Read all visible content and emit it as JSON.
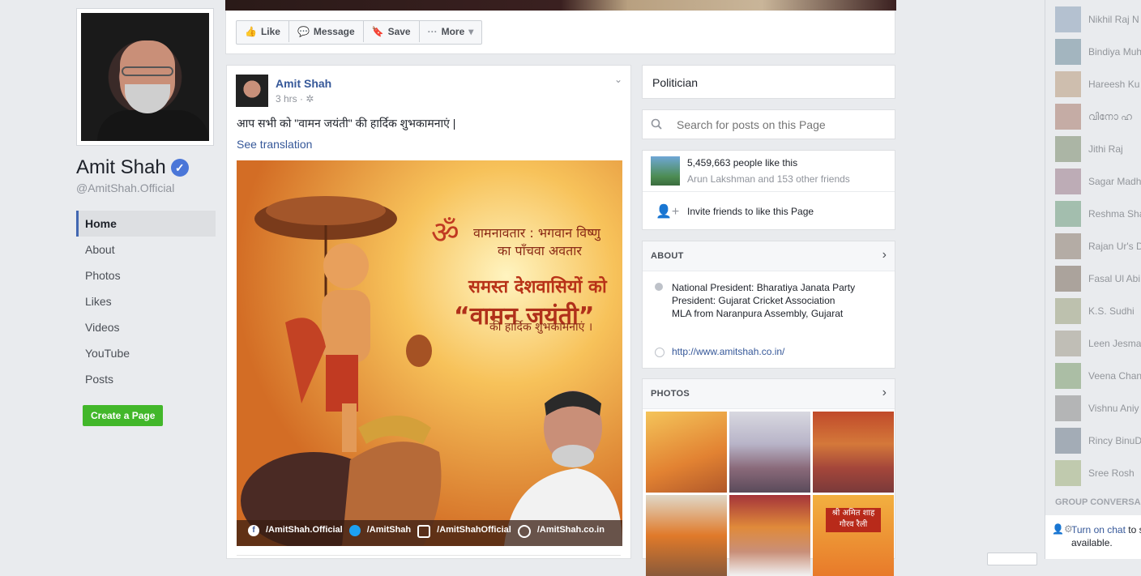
{
  "page": {
    "name": "Amit Shah",
    "handle": "@AmitShah.Official",
    "verified_icon": "verified-badge-icon"
  },
  "left_nav": {
    "items": [
      {
        "label": "Home",
        "active": true
      },
      {
        "label": "About"
      },
      {
        "label": "Photos"
      },
      {
        "label": "Likes"
      },
      {
        "label": "Videos"
      },
      {
        "label": "YouTube"
      },
      {
        "label": "Posts"
      }
    ],
    "create_page": "Create a Page"
  },
  "action_bar": {
    "like": "Like",
    "message": "Message",
    "save": "Save",
    "more": "More"
  },
  "post": {
    "author": "Amit Shah",
    "time": "3 hrs · ",
    "text": "आप सभी को \"वामन जयंती\" की हार्दिक शुभकामनाएं |",
    "see_translation": "See translation",
    "image": {
      "title_line1": "वामनावतार : भगवान विष्णु",
      "title_line2": "का पाँचवा अवतार",
      "greeting_line1": "समस्त देशवासियों को",
      "greeting_line2": "“वामन जयंती”",
      "greeting_line3": "की हार्दिक शुभकामनाएं ।",
      "om": "ॐ",
      "social": [
        {
          "icon": "facebook-icon",
          "label": "/AmitShah.Official"
        },
        {
          "icon": "twitter-icon",
          "label": "/AmitShah"
        },
        {
          "icon": "instagram-icon",
          "label": "/AmitShahOfficial"
        },
        {
          "icon": "web-icon",
          "label": "/AmitShah.co.in"
        }
      ]
    }
  },
  "right": {
    "category": "Politician",
    "search_placeholder": "Search for posts on this Page",
    "likes_count": "5,459,663 people like this",
    "likes_friends": "Arun Lakshman and 153 other friends",
    "invite": "Invite friends to like this Page",
    "about": {
      "heading": "ABOUT",
      "lines": [
        "National President: Bharatiya Janata Party",
        "President: Gujarat Cricket Association",
        "MLA from Naranpura Assembly, Gujarat"
      ],
      "website": "http://www.amitshah.co.in/"
    },
    "photos": {
      "heading": "PHOTOS",
      "poster_line1": "श्री अमित शाह",
      "poster_line2": "गौरव रैली"
    }
  },
  "chat": {
    "contacts": [
      "Nikhil Raj N",
      "Bindiya Muh",
      "Hareesh Ku",
      "വിനോ ഹ",
      "Jithi Raj",
      "Sagar Madh",
      "Reshma Sha",
      "Rajan Ur's D",
      "Fasal Ul Abi",
      "K.S. Sudhi",
      "Leen Jesma",
      "Veena Chan",
      "Vishnu Aniy",
      "Rincy BinuD",
      "Sree Rosh"
    ],
    "group_heading": "GROUP CONVERSA",
    "turn_on_link": "Turn on chat",
    "turn_on_rest": " to s available."
  }
}
